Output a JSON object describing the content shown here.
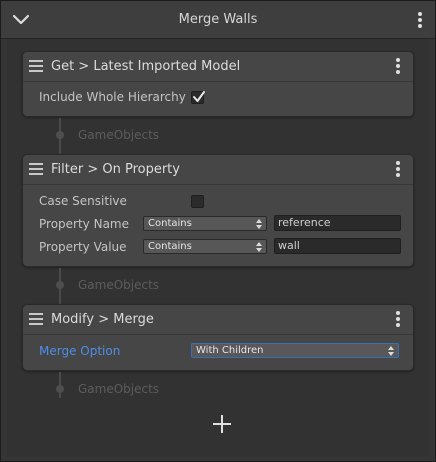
{
  "window": {
    "title": "Merge Walls"
  },
  "icons": {
    "collapse": "chevron-down-icon",
    "menu": "kebab-menu-icon",
    "drag": "hamburger-icon",
    "add": "plus-icon"
  },
  "colors": {
    "accent_blue": "#4d8ee8",
    "card_bg": "#464646",
    "panel_bg": "#353535",
    "muted_label": "#5c5c5c"
  },
  "nodes": [
    {
      "title": "Get > Latest Imported Model",
      "props": {
        "include_whole_hierarchy_label": "Include Whole Hierarchy",
        "include_whole_hierarchy_checked": true
      }
    },
    {
      "title": "Filter > On Property",
      "props": {
        "case_sensitive_label": "Case Sensitive",
        "case_sensitive_checked": false,
        "property_name_label": "Property Name",
        "property_name_mode": "Contains",
        "property_name_value": "reference",
        "property_value_label": "Property Value",
        "property_value_mode": "Contains",
        "property_value_value": "wall"
      }
    },
    {
      "title": "Modify > Merge",
      "props": {
        "merge_option_label": "Merge Option",
        "merge_option_value": "With Children"
      }
    }
  ],
  "connectors": [
    {
      "label": "GameObjects"
    },
    {
      "label": "GameObjects"
    },
    {
      "label": "GameObjects"
    }
  ]
}
